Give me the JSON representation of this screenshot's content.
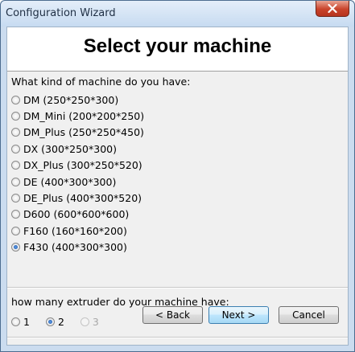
{
  "window": {
    "title": "Configuration Wizard"
  },
  "page": {
    "heading": "Select your machine"
  },
  "machine": {
    "question": "What kind of machine do you have:",
    "selected": "F430",
    "options": [
      {
        "label": "DM (250*250*300)",
        "checked": false
      },
      {
        "label": "DM_Mini (200*200*250)",
        "checked": false
      },
      {
        "label": "DM_Plus (250*250*450)",
        "checked": false
      },
      {
        "label": "DX (300*250*300)",
        "checked": false
      },
      {
        "label": "DX_Plus (300*250*520)",
        "checked": false
      },
      {
        "label": "DE (400*300*300)",
        "checked": false
      },
      {
        "label": "DE_Plus (400*300*520)",
        "checked": false
      },
      {
        "label": "D600 (600*600*600)",
        "checked": false
      },
      {
        "label": "F160 (160*160*200)",
        "checked": false
      },
      {
        "label": "F430 (400*300*300)",
        "checked": true
      }
    ]
  },
  "extruder": {
    "question": "how many extruder do your machine have:",
    "options": [
      {
        "label": "1",
        "checked": false,
        "enabled": true
      },
      {
        "label": "2",
        "checked": true,
        "enabled": true
      },
      {
        "label": "3",
        "checked": false,
        "enabled": false
      }
    ]
  },
  "buttons": {
    "back": "< Back",
    "next": "Next >",
    "cancel": "Cancel"
  }
}
